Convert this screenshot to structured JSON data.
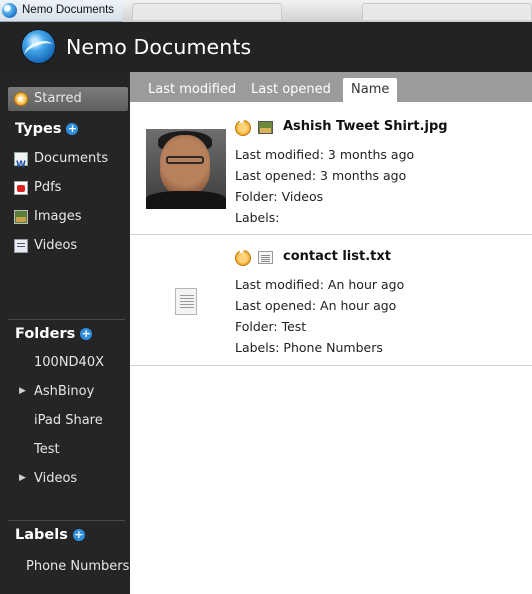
{
  "window": {
    "title": "Nemo Documents"
  },
  "header": {
    "app_name": "Nemo Documents"
  },
  "sidebar": {
    "starred_label": "Starred",
    "types_title": "Types",
    "types": [
      {
        "label": "Documents",
        "icon": "word-document-icon"
      },
      {
        "label": "Pdfs",
        "icon": "pdf-icon"
      },
      {
        "label": "Images",
        "icon": "image-icon"
      },
      {
        "label": "Videos",
        "icon": "video-icon"
      }
    ],
    "folders_title": "Folders",
    "folders": [
      {
        "label": "100ND40X",
        "expandable": false
      },
      {
        "label": "AshBinoy",
        "expandable": true
      },
      {
        "label": "iPad Share",
        "expandable": false
      },
      {
        "label": "Test",
        "expandable": false
      },
      {
        "label": "Videos",
        "expandable": true
      }
    ],
    "labels_title": "Labels",
    "labels": [
      {
        "label": "Phone Numbers"
      }
    ]
  },
  "tabs": [
    {
      "label": "Last modified",
      "selected": false
    },
    {
      "label": "Last opened",
      "selected": false
    },
    {
      "label": "Name",
      "selected": true
    }
  ],
  "files": [
    {
      "name": "Ashish Tweet Shirt.jpg",
      "type_icon": "image-file-icon",
      "starred": true,
      "last_modified": "Last modified: 3 months ago",
      "last_opened": "Last opened: 3 months ago",
      "folder": "Folder: Videos",
      "labels": "Labels:"
    },
    {
      "name": "contact list.txt",
      "type_icon": "text-file-icon",
      "starred": true,
      "last_modified": "Last modified: An hour ago",
      "last_opened": "Last opened: An hour ago",
      "folder": "Folder: Test",
      "labels": "Labels: Phone Numbers"
    }
  ],
  "colors": {
    "accent": "#2e8fe0",
    "star": "#e89b12",
    "sidebar_bg": "#252525",
    "tabbar_bg": "#9b9b9b"
  }
}
